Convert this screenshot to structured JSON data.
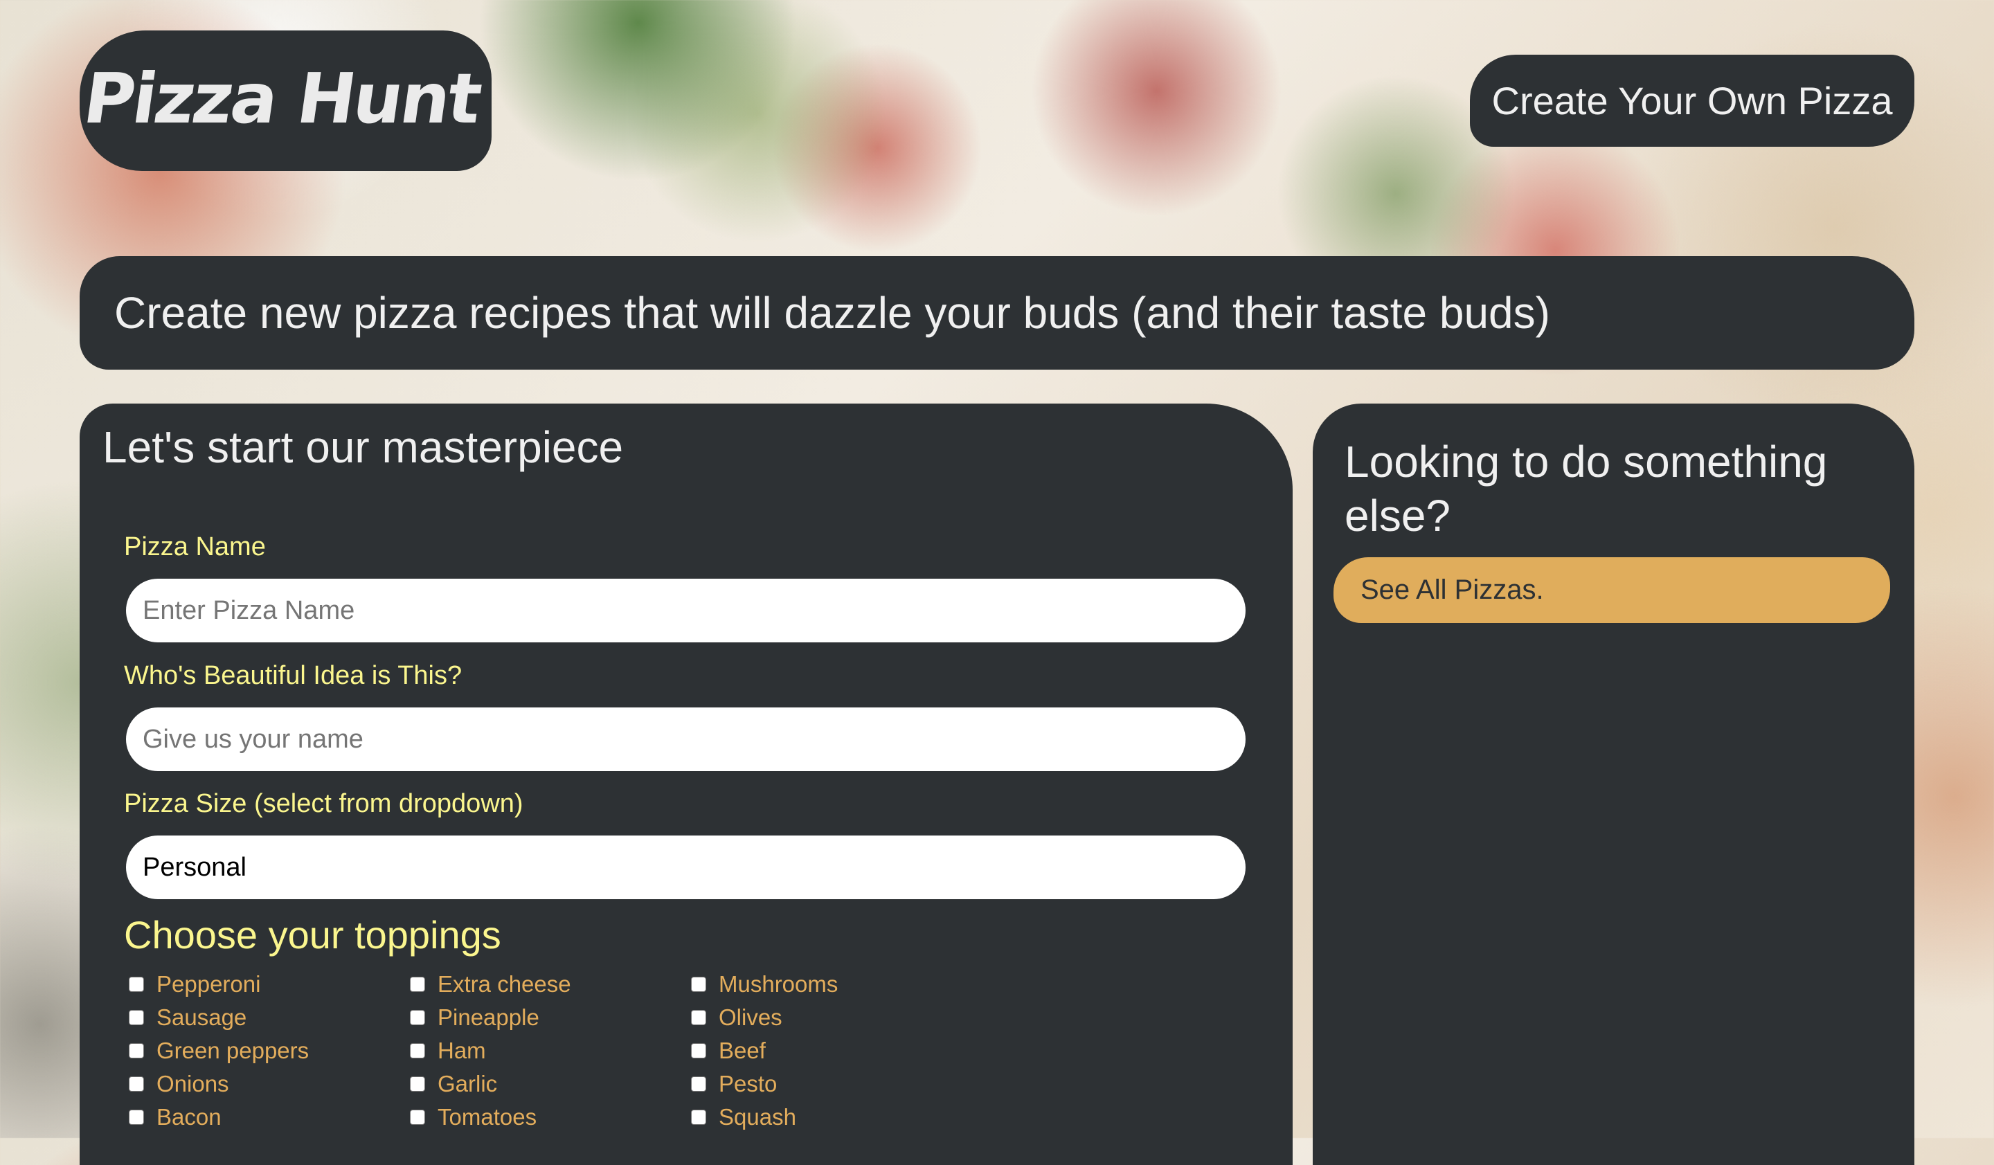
{
  "header": {
    "logo_text": "Pizza Hunt",
    "nav_button_label": "Create Your Own Pizza"
  },
  "banner": {
    "text": "Create new pizza recipes that will dazzle your buds (and their taste buds)"
  },
  "form": {
    "title": "Let's start our masterpiece",
    "pizza_name": {
      "label": "Pizza Name",
      "placeholder": "Enter Pizza Name",
      "value": ""
    },
    "created_by": {
      "label": "Who's Beautiful Idea is This?",
      "placeholder": "Give us your name",
      "value": ""
    },
    "size": {
      "label": "Pizza Size (select from dropdown)",
      "selected": "Personal"
    },
    "toppings_heading": "Choose your toppings",
    "toppings": [
      [
        "Pepperoni",
        "Sausage",
        "Green peppers",
        "Onions",
        "Bacon"
      ],
      [
        "Extra cheese",
        "Pineapple",
        "Ham",
        "Garlic",
        "Tomatoes"
      ],
      [
        "Mushrooms",
        "Olives",
        "Beef",
        "Pesto",
        "Squash"
      ]
    ]
  },
  "sidebar": {
    "title": "Looking to do something else?",
    "link_label": "See All Pizzas."
  },
  "colors": {
    "panel_bg": "#2d3134",
    "label_yellow": "#fbf68e",
    "topping_orange": "#e3ad5c",
    "accent_button": "#e0ad5c",
    "text_light": "#f0f0f0"
  }
}
